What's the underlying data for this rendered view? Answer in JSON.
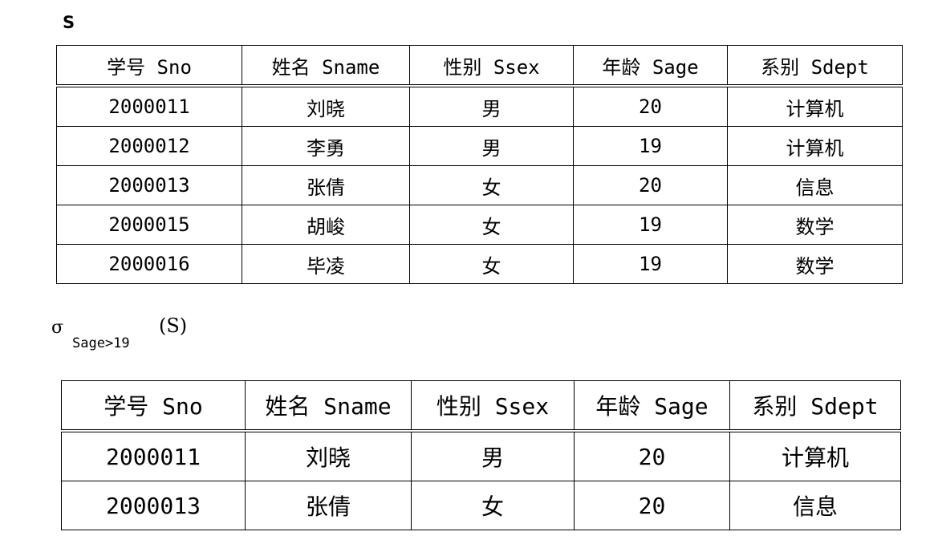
{
  "relation_label": "S",
  "selection": {
    "symbol": "σ",
    "condition": "Sage>19",
    "argument": "(S)"
  },
  "columns": [
    "学号 Sno",
    "姓名 Sname",
    "性别 Ssex",
    "年龄 Sage",
    "系别 Sdept"
  ],
  "table_s": {
    "rows": [
      [
        "2000011",
        "刘晓",
        "男",
        "20",
        "计算机"
      ],
      [
        "2000012",
        "李勇",
        "男",
        "19",
        "计算机"
      ],
      [
        "2000013",
        "张倩",
        "女",
        "20",
        "信息"
      ],
      [
        "2000015",
        "胡峻",
        "女",
        "19",
        "数学"
      ],
      [
        "2000016",
        "毕凌",
        "女",
        "19",
        "数学"
      ]
    ]
  },
  "table_result": {
    "rows": [
      [
        "2000011",
        "刘晓",
        "男",
        "20",
        "计算机"
      ],
      [
        "2000013",
        "张倩",
        "女",
        "20",
        "信息"
      ]
    ]
  }
}
